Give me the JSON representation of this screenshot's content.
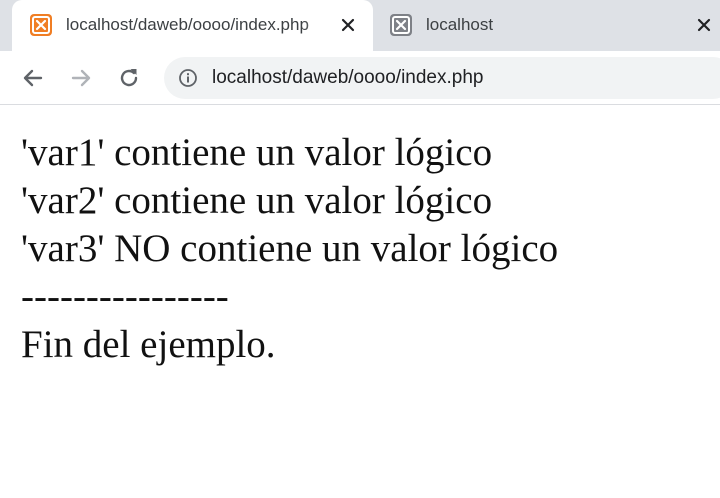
{
  "tabs": [
    {
      "title": "localhost/daweb/oooo/index.php",
      "active": true,
      "favicon": "xampp-icon",
      "favicon_color": "#f07e24"
    },
    {
      "title": "localhost",
      "active": false,
      "favicon": "xampp-icon",
      "favicon_color": "#7e8187"
    }
  ],
  "toolbar": {
    "back_icon": "arrow-left-icon",
    "forward_icon": "arrow-right-icon",
    "reload_icon": "reload-icon",
    "address": "localhost/daweb/oooo/index.php",
    "security_icon": "info-icon"
  },
  "page": {
    "lines": [
      "'var1' contiene un valor lógico",
      "'var2' contiene un valor lógico",
      "'var3' NO contiene un valor lógico",
      "----------------",
      "Fin del ejemplo."
    ]
  },
  "colors": {
    "tabstrip": "#dee1e6",
    "omnibox": "#f1f3f4",
    "text": "#111111"
  }
}
